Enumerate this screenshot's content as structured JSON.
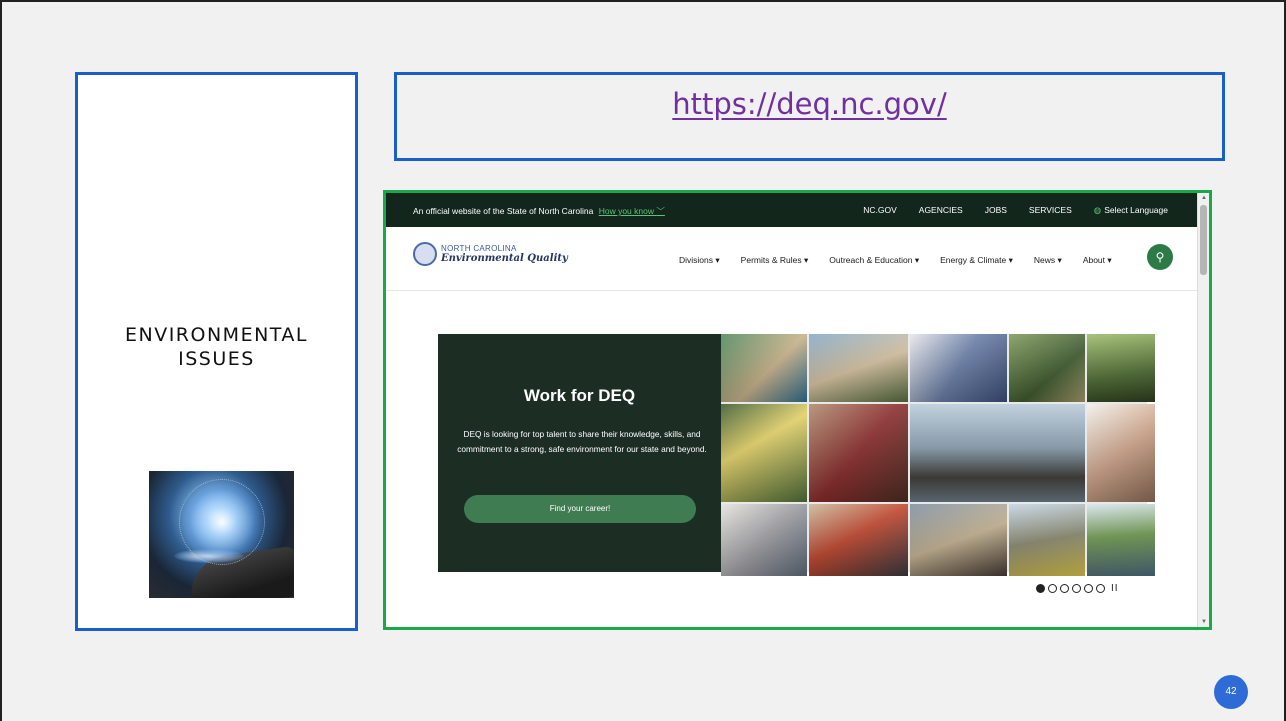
{
  "slide": {
    "left_title_line1": "ENVIRONMENTAL",
    "left_title_line2": "ISSUES",
    "url": "https://deq.nc.gov/",
    "page_number": "42"
  },
  "website": {
    "official_text": "An official website of the State of North Carolina",
    "how_you_know": "How you know",
    "top_nav": [
      "NC.GOV",
      "AGENCIES",
      "JOBS",
      "SERVICES"
    ],
    "select_language": "Select Language",
    "logo_line1": "NORTH CAROLINA",
    "logo_line2": "Environmental Quality",
    "main_nav": [
      "Divisions",
      "Permits & Rules",
      "Outreach & Education",
      "Energy & Climate",
      "News",
      "About"
    ],
    "hero": {
      "title": "Work for DEQ",
      "description": "DEQ is looking for top talent to share their knowledge, skills, and commitment to a strong, safe environment for our state and beyond.",
      "button": "Find your career!"
    },
    "carousel_slides": 6,
    "carousel_active": 1
  },
  "colors": {
    "accent_blue": "#1a5fc8",
    "browser_border": "#1aa84a",
    "url_color": "#7030a0",
    "deq_dark_green": "#1c2e23",
    "deq_button_green": "#3f7c52",
    "page_badge": "#2e6bd6"
  }
}
